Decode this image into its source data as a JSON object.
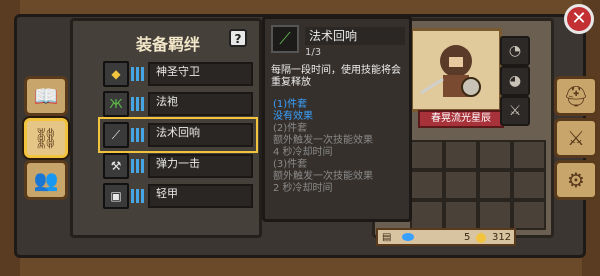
{
  "panel": {
    "title": "装备羁绊",
    "help_label": "?"
  },
  "bonds": [
    {
      "label": "神圣守卫",
      "icon": "shield-icon",
      "icon_color": "#f2c43e"
    },
    {
      "label": "法袍",
      "icon": "robe-icon",
      "icon_color": "#5fbf4b"
    },
    {
      "label": "法术回响",
      "icon": "staff-icon",
      "icon_color": "#e8e8e8"
    },
    {
      "label": "弹力一击",
      "icon": "hammer-icon",
      "icon_color": "#e8e8e8"
    },
    {
      "label": "轻甲",
      "icon": "armor-icon",
      "icon_color": "#e8e8e8"
    }
  ],
  "tooltip": {
    "name": "法术回响",
    "level": "1/3",
    "description": "每隔一段时间，使用技能将会重复释放",
    "lines": [
      {
        "text": "(1)件套",
        "color": "#3aa0ff"
      },
      {
        "text": "没有效果",
        "color": "#3aa0ff"
      },
      {
        "text": "(2)件套",
        "color": "#8a8a8a"
      },
      {
        "text": "额外触发一次技能效果",
        "color": "#8a8a8a"
      },
      {
        "text": "4 秒冷却时间",
        "color": "#8a8a8a"
      },
      {
        "text": "(3)件套",
        "color": "#8a8a8a"
      },
      {
        "text": "额外触发一次技能效果",
        "color": "#8a8a8a"
      },
      {
        "text": "2 秒冷却时间",
        "color": "#8a8a8a"
      }
    ]
  },
  "character": {
    "name": "春晃流光星辰"
  },
  "resources": {
    "gems": "5",
    "coins": "312"
  },
  "close_label": "✕"
}
